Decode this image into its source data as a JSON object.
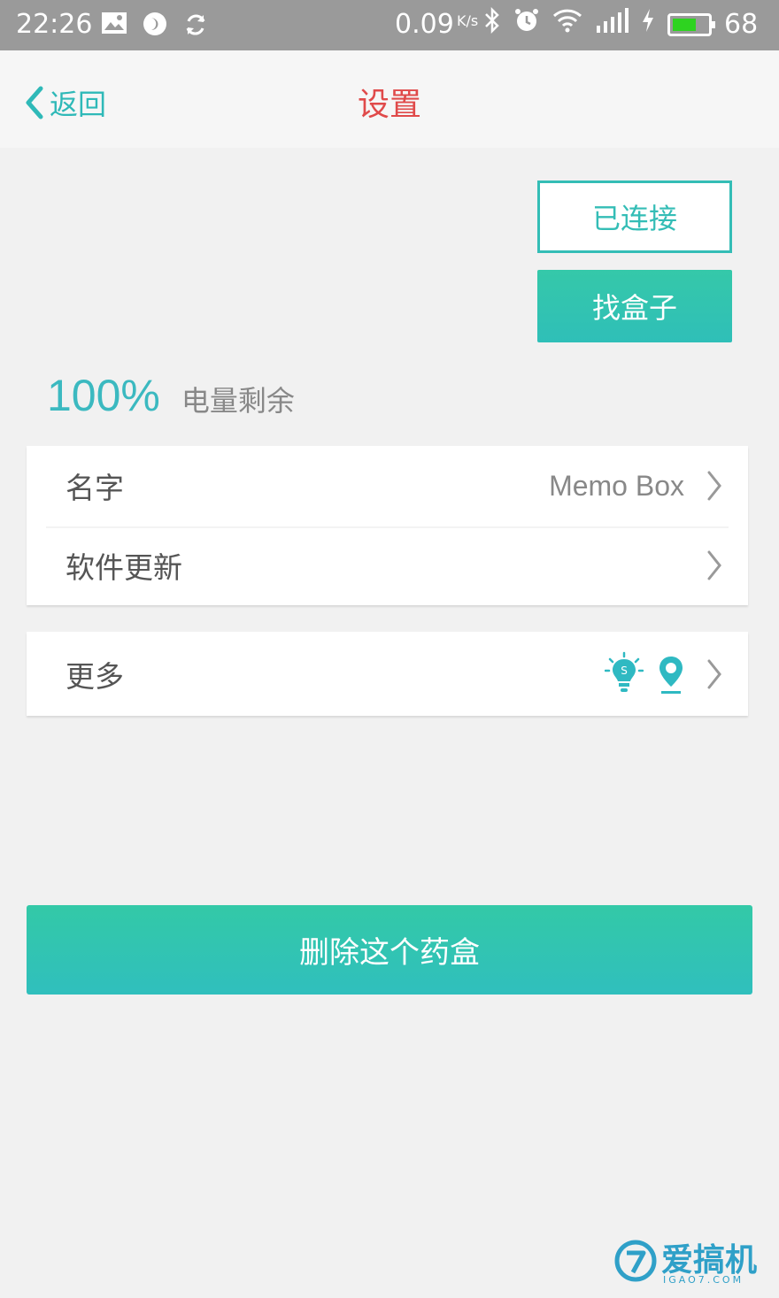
{
  "status_bar": {
    "time": "22:26",
    "speed": "0.09",
    "speed_unit": "K/s",
    "battery_level": "68",
    "battery_fraction": 0.68,
    "icons_left": [
      "image-icon",
      "app-icon",
      "sync-icon"
    ],
    "icons_right": [
      "bluetooth-icon",
      "alarm-icon",
      "wifi-icon",
      "signal-icon",
      "charging-icon",
      "battery-icon"
    ]
  },
  "nav": {
    "back_label": "返回",
    "title": "设置"
  },
  "connection": {
    "connected_label": "已连接",
    "find_box_label": "找盒子"
  },
  "battery": {
    "percent": "100%",
    "label": "电量剩余"
  },
  "list": {
    "name_label": "名字",
    "name_value": "Memo Box",
    "update_label": "软件更新",
    "more_label": "更多"
  },
  "delete_label": "删除这个药盒",
  "watermark": {
    "text": "爱搞机",
    "sub": "IGAO7.COM"
  },
  "colors": {
    "accent": "#34bdb6",
    "title": "#e04a4a",
    "background": "#f1f1f1"
  }
}
